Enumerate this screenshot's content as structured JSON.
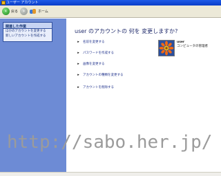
{
  "window": {
    "title": "ユーザー アカウント"
  },
  "toolbar": {
    "back_label": "戻る",
    "home_label": "ホーム"
  },
  "sidebar": {
    "task_header": "関連した作業",
    "tasks": [
      {
        "label": "ほかのアカウントを変更する"
      },
      {
        "label": "新しいアカウントを作成する"
      }
    ]
  },
  "main": {
    "question": "user のアカウントの 何を 変更しますか?",
    "actions": [
      {
        "label": "名前を変更する"
      },
      {
        "label": "パスワードを作成する"
      },
      {
        "label": "画像を変更する"
      },
      {
        "label": "アカウントの種類を変更する"
      },
      {
        "label": "アカウントを削除する"
      }
    ],
    "account": {
      "name": "user",
      "role": "コンピュータの管理者",
      "avatar_icon": "flower-icon"
    }
  },
  "watermark": "http://sabo.her.jp/"
}
